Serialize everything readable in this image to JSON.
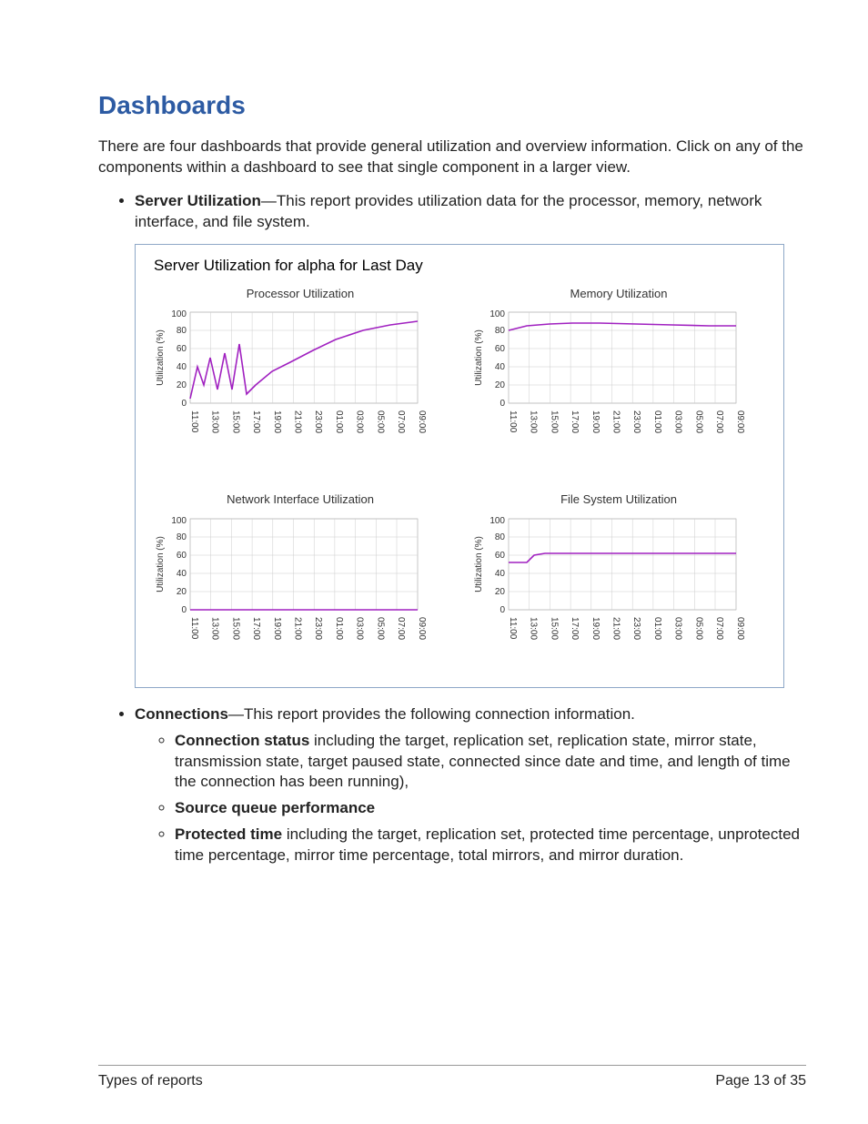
{
  "heading": "Dashboards",
  "intro": "There are four dashboards that provide general utilization and overview information. Click on any of the components within a dashboard to see that single component in a larger view.",
  "bullets": {
    "server_util": {
      "head": "Server Utilization",
      "body": "—This report provides utilization data for the processor, memory, network interface, and file system."
    },
    "connections": {
      "head": "Connections",
      "body": "—This report provides the following connection information.",
      "sub": {
        "conn_status": {
          "head": "Connection status",
          "body": " including the target, replication set, replication state, mirror state, transmission state, target paused state, connected since date and time, and length of time the connection has been running),"
        },
        "source_queue": {
          "head": "Source queue performance",
          "body": ""
        },
        "protected_time": {
          "head": "Protected time",
          "body": " including the target, replication set, protected time percentage, unprotected time percentage, mirror time percentage, total mirrors, and mirror duration."
        }
      }
    }
  },
  "dashboard_title": "Server Utilization for alpha for Last Day",
  "chart_titles": {
    "proc": "Processor Utilization",
    "mem": "Memory Utilization",
    "net": "Network Interface Utilization",
    "fs": "File System Utilization"
  },
  "ylabel": "Utilization (%)",
  "chart_data": [
    {
      "type": "line",
      "title": "Processor Utilization",
      "xlabel": "",
      "ylabel": "Utilization (%)",
      "ylim": [
        0,
        100
      ],
      "categories": [
        "11:00",
        "13:00",
        "15:00",
        "17:00",
        "19:00",
        "21:00",
        "23:00",
        "01:00",
        "03:00",
        "05:00",
        "07:00",
        "09:00"
      ],
      "values": [
        5,
        40,
        20,
        50,
        15,
        55,
        15,
        65,
        10,
        20,
        28,
        35,
        43,
        50,
        58,
        65,
        72,
        80,
        87,
        90
      ],
      "series_note": "first ~half oscillates 5-65, then linear ramp to ~90",
      "line_color": "#a020c0"
    },
    {
      "type": "line",
      "title": "Memory Utilization",
      "xlabel": "",
      "ylabel": "Utilization (%)",
      "ylim": [
        0,
        100
      ],
      "categories": [
        "11:00",
        "13:00",
        "15:00",
        "17:00",
        "19:00",
        "21:00",
        "23:00",
        "01:00",
        "03:00",
        "05:00",
        "07:00",
        "09:00"
      ],
      "values": [
        80,
        85,
        87,
        88,
        88,
        88,
        87,
        87,
        86,
        86,
        85,
        85
      ],
      "line_color": "#a020c0"
    },
    {
      "type": "line",
      "title": "Network Interface Utilization",
      "xlabel": "",
      "ylabel": "Utilization (%)",
      "ylim": [
        0,
        100
      ],
      "categories": [
        "11:00",
        "13:00",
        "15:00",
        "17:00",
        "19:00",
        "21:00",
        "23:00",
        "01:00",
        "03:00",
        "05:00",
        "07:00",
        "09:00"
      ],
      "values": [
        0,
        0,
        0,
        0,
        0,
        0,
        0,
        0,
        0,
        0,
        0,
        0
      ],
      "line_color": "#a020c0"
    },
    {
      "type": "line",
      "title": "File System Utilization",
      "xlabel": "",
      "ylabel": "Utilization (%)",
      "ylim": [
        0,
        100
      ],
      "categories": [
        "11:00",
        "13:00",
        "15:00",
        "17:00",
        "19:00",
        "21:00",
        "23:00",
        "01:00",
        "03:00",
        "05:00",
        "07:00",
        "09:00"
      ],
      "values": [
        52,
        52,
        60,
        62,
        62,
        62,
        62,
        62,
        62,
        62,
        62,
        62
      ],
      "line_color": "#a020c0"
    }
  ],
  "footer": {
    "left": "Types of reports",
    "right": "Page 13 of 35"
  }
}
